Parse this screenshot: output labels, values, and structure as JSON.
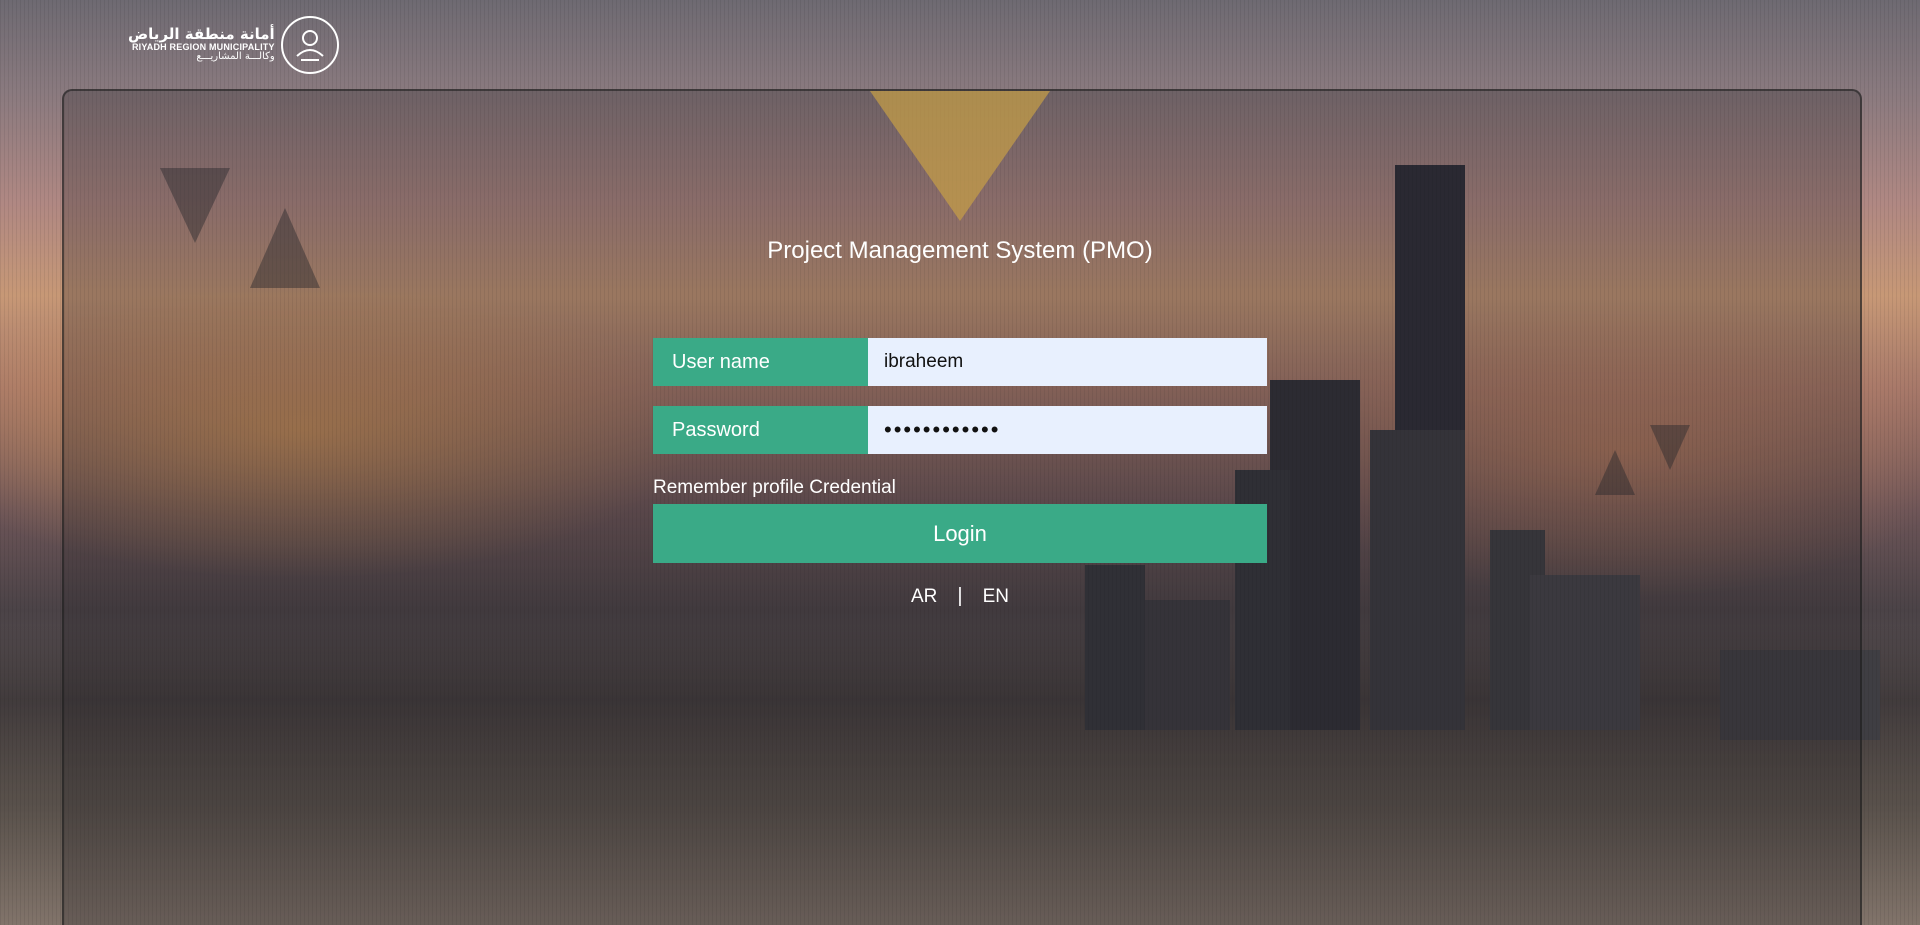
{
  "branding": {
    "logo_ar": "أمانة منطقة الرياض",
    "logo_en": "RIYADH REGION MUNICIPALITY",
    "logo_sub": "وكالـــة المشاريـــع",
    "seal_icon": "riyadh-seal-icon"
  },
  "login": {
    "title": "Project Management System (PMO)",
    "username_label": "User name",
    "username_value": "ibraheem",
    "password_label": "Password",
    "password_value": "••••••••••••",
    "remember_label": "Remember profile Credential",
    "login_button": "Login"
  },
  "language": {
    "ar": "AR",
    "separator": "|",
    "en": "EN"
  },
  "colors": {
    "accent": "#3aaa87",
    "input_bg": "#e8f0fe"
  }
}
